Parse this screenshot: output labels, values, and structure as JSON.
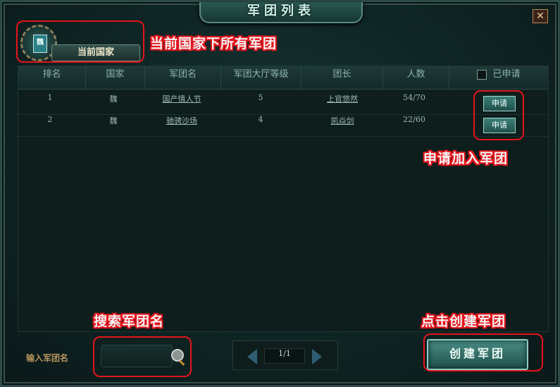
{
  "window": {
    "title": "军团列表",
    "close_label": "✕"
  },
  "nation": {
    "emblem_text": "魏",
    "label": "当前国家"
  },
  "table": {
    "headers": [
      "排名",
      "国家",
      "军团名",
      "军团大厅等级",
      "团长",
      "人数",
      "已申请"
    ],
    "rows": [
      {
        "rank": "1",
        "nation": "魏",
        "name": "国产情人节",
        "level": "5",
        "leader": "上官悠然",
        "members": "54/70",
        "action": "申请"
      },
      {
        "rank": "2",
        "nation": "魏",
        "name": "驰骋沙场",
        "level": "4",
        "leader": "凯焱剑",
        "members": "22/60",
        "action": "申请"
      }
    ]
  },
  "search": {
    "label": "输入军团名",
    "value": ""
  },
  "pager": {
    "page": "1/1"
  },
  "create_button": "创建军团",
  "annotations": {
    "nation_note": "当前国家下所有军团",
    "apply_note": "申请加入军团",
    "search_note": "搜索军团名",
    "create_note": "点击创建军团"
  },
  "colors": {
    "annotation_box": "#e4141c",
    "panel_bg": "#0f2424",
    "header_text": "#8fb3aa"
  }
}
